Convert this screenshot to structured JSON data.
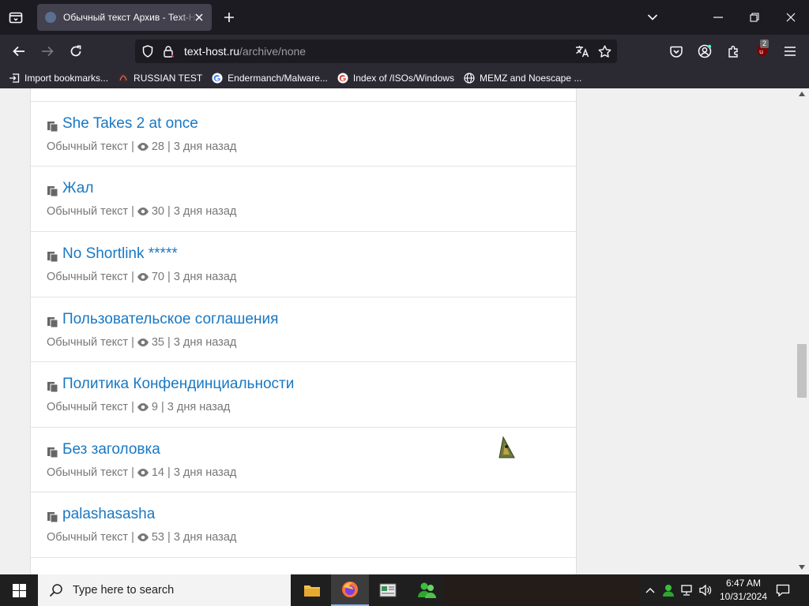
{
  "browser": {
    "tab": {
      "title": "Обычный текст Архив - Text-Host"
    },
    "url": {
      "host": "text-host.ru",
      "path": "/archive/none"
    },
    "extension_badge": "2",
    "bookmarks": [
      {
        "label": "Import bookmarks...",
        "icon": "import-icon"
      },
      {
        "label": "RUSSIAN TEST",
        "icon": "site-favicon"
      },
      {
        "label": "Endermanch/Malware...",
        "icon": "google-icon"
      },
      {
        "label": "Index of /ISOs/Windows",
        "icon": "google-icon"
      },
      {
        "label": "MEMZ and Noescape ...",
        "icon": "globe-icon"
      }
    ]
  },
  "posts": [
    {
      "title": "She Takes 2 at once",
      "type": "Обычный текст",
      "views": "28",
      "age": "3 дня назад"
    },
    {
      "title": "Жал",
      "type": "Обычный текст",
      "views": "30",
      "age": "3 дня назад"
    },
    {
      "title": "No Shortlink *****",
      "type": "Обычный текст",
      "views": "70",
      "age": "3 дня назад"
    },
    {
      "title": "Пользовательское соглашения",
      "type": "Обычный текст",
      "views": "35",
      "age": "3 дня назад"
    },
    {
      "title": "Политика Конфендинциальности",
      "type": "Обычный текст",
      "views": "9",
      "age": "3 дня назад"
    },
    {
      "title": "Без заголовка",
      "type": "Обычный текст",
      "views": "14",
      "age": "3 дня назад"
    },
    {
      "title": "palashasasha",
      "type": "Обычный текст",
      "views": "53",
      "age": "3 дня назад"
    }
  ],
  "taskbar": {
    "search_placeholder": "Type here to search",
    "time": "6:47 AM",
    "date": "10/31/2024"
  },
  "colors": {
    "link": "#1a78c2",
    "tab_bg": "#1c1b22",
    "toolbar_bg": "#2b2a33"
  }
}
